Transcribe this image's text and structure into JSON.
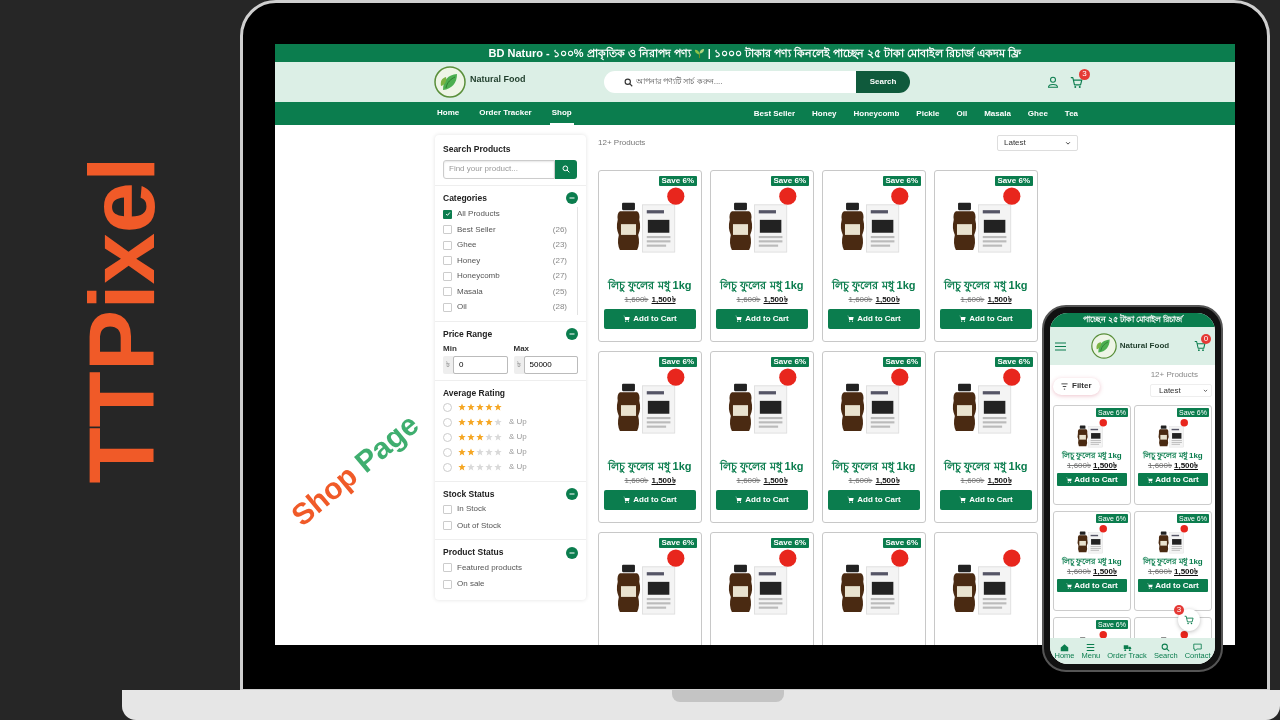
{
  "brand_overlay": {
    "text": "TTPixel"
  },
  "caption_overlay": {
    "words": [
      {
        "text": "Shop",
        "color": "#f05a28"
      },
      {
        "text": "Page",
        "color": "#3fae6f"
      }
    ]
  },
  "desktop": {
    "announcement": {
      "text_start": "BD Naturo - ১০০% প্রাকৃতিক ও নিরাপদ পণ্য",
      "text_end": "| ১০০০ টাকার পণ্য কিনলেই পাচ্ছেন ২৫ টাকা মোবাইল রিচার্জ একদম ফ্রি"
    },
    "logo_text": "Natural Food",
    "search": {
      "placeholder": "আপনার পণ্যটি সার্চ করুন....",
      "button": "Search"
    },
    "cart_count": "3",
    "nav_left": [
      {
        "label": "Home",
        "selected": false
      },
      {
        "label": "Order Tracker",
        "selected": false
      },
      {
        "label": "Shop",
        "selected": true
      }
    ],
    "nav_right": [
      "Best Seller",
      "Honey",
      "Honeycomb",
      "Pickle",
      "Oil",
      "Masala",
      "Ghee",
      "Tea"
    ],
    "sidebar": {
      "search": {
        "title": "Search Products",
        "placeholder": "Find your product..."
      },
      "categories": {
        "title": "Categories",
        "expanded": true,
        "items": [
          {
            "label": "All Products",
            "checked": true
          },
          {
            "label": "Best Seller",
            "count": "(26)",
            "checked": false
          },
          {
            "label": "Ghee",
            "count": "(23)",
            "checked": false
          },
          {
            "label": "Honey",
            "count": "(27)",
            "checked": false
          },
          {
            "label": "Honeycomb",
            "count": "(27)",
            "checked": false
          },
          {
            "label": "Masala",
            "count": "(25)",
            "checked": false
          },
          {
            "label": "Oil",
            "count": "(28)",
            "checked": false
          }
        ]
      },
      "price": {
        "title": "Price Range",
        "expanded": true,
        "currency": "৳",
        "min_label": "Min",
        "min_value": "0",
        "max_label": "Max",
        "max_value": "50000"
      },
      "rating": {
        "title": "Average Rating",
        "options": [
          {
            "stars": 5,
            "selected": false
          },
          {
            "stars": 4,
            "suffix": "& Up",
            "selected": false
          },
          {
            "stars": 3,
            "suffix": "& Up",
            "selected": false
          },
          {
            "stars": 2,
            "suffix": "& Up",
            "selected": false
          },
          {
            "stars": 1,
            "suffix": "& Up",
            "selected": false
          }
        ]
      },
      "stock": {
        "title": "Stock Status",
        "expanded": true,
        "items": [
          {
            "label": "In Stock",
            "checked": false
          },
          {
            "label": "Out of Stock",
            "checked": false
          }
        ]
      },
      "product_status": {
        "title": "Product Status",
        "expanded": true,
        "items": [
          {
            "label": "Featured products",
            "checked": false
          },
          {
            "label": "On sale",
            "checked": false
          }
        ]
      }
    },
    "toolbar": {
      "count": "12+ Products",
      "sort": "Latest"
    },
    "products": [
      {
        "image": true,
        "badge": "Save 6%",
        "name": "লিচু ফুলের মধু 1kg",
        "old_price": "1,600৳",
        "price": "1,500৳",
        "button": "Add to Cart"
      },
      {
        "image": true,
        "badge": "Save 6%",
        "name": "লিচু ফুলের মধু 1kg",
        "old_price": "1,600৳",
        "price": "1,500৳",
        "button": "Add to Cart"
      },
      {
        "image": true,
        "badge": "Save 6%",
        "name": "লিচু ফুলের মধু 1kg",
        "old_price": "1,600৳",
        "price": "1,500৳",
        "button": "Add to Cart"
      },
      {
        "image": true,
        "badge": "Save 6%",
        "name": "লিচু ফুলের মধু 1kg",
        "old_price": "1,600৳",
        "price": "1,500৳",
        "button": "Add to Cart"
      },
      {
        "image": true,
        "badge": "Save 6%",
        "name": "লিচু ফুলের মধু 1kg",
        "old_price": "1,600৳",
        "price": "1,500৳",
        "button": "Add to Cart"
      },
      {
        "image": true,
        "badge": "Save 6%",
        "name": "লিচু ফুলের মধু 1kg",
        "old_price": "1,600৳",
        "price": "1,500৳",
        "button": "Add to Cart"
      },
      {
        "image": true,
        "badge": "Save 6%",
        "name": "লিচু ফুলের মধু 1kg",
        "old_price": "1,600৳",
        "price": "1,500৳",
        "button": "Add to Cart"
      },
      {
        "image": true,
        "badge": "Save 6%",
        "name": "লিচু ফুলের মধু 1kg",
        "old_price": "1,600৳",
        "price": "1,500৳",
        "button": "Add to Cart"
      },
      {
        "image": true,
        "badge": "Save 6%"
      },
      {
        "image": true,
        "badge": "Save 6%"
      },
      {
        "image": true,
        "badge": "Save 6%"
      },
      {
        "image": true
      }
    ]
  },
  "mobile": {
    "announcement": "পাচ্ছেন ২৫ টাকা মোবাইল রিচার্জ",
    "logo_text": "Natural Food",
    "cart_count": "0",
    "filter": "Filter",
    "count": "12+ Products",
    "sort": "Latest",
    "products": [
      {
        "image": true,
        "badge": "Save 6%",
        "name": "লিচু ফুলের মধু 1kg",
        "old_price": "1,600৳",
        "price": "1,500৳",
        "button": "Add to Cart"
      },
      {
        "image": true,
        "badge": "Save 6%",
        "name": "লিচু ফুলের মধু 1kg",
        "old_price": "1,600৳",
        "price": "1,500৳",
        "button": "Add to Cart"
      },
      {
        "image": true,
        "badge": "Save 6%",
        "name": "লিচু ফুলের মধু 1kg",
        "old_price": "1,600৳",
        "price": "1,500৳",
        "button": "Add to Cart"
      },
      {
        "image": true,
        "badge": "Save 6%",
        "name": "লিচু ফুলের মধু 1kg",
        "old_price": "1,600৳",
        "price": "1,500৳",
        "button": "Add to Cart"
      },
      {
        "image": true,
        "badge": "Save 6%"
      },
      {
        "image": true
      }
    ],
    "floating_cart_count": "3",
    "bottom_nav": [
      {
        "kind": "home",
        "label": "Home"
      },
      {
        "kind": "menu",
        "label": "Menu"
      },
      {
        "kind": "truck",
        "label": "Order Track"
      },
      {
        "kind": "search",
        "label": "Search"
      },
      {
        "kind": "chat",
        "label": "Contact"
      }
    ]
  }
}
